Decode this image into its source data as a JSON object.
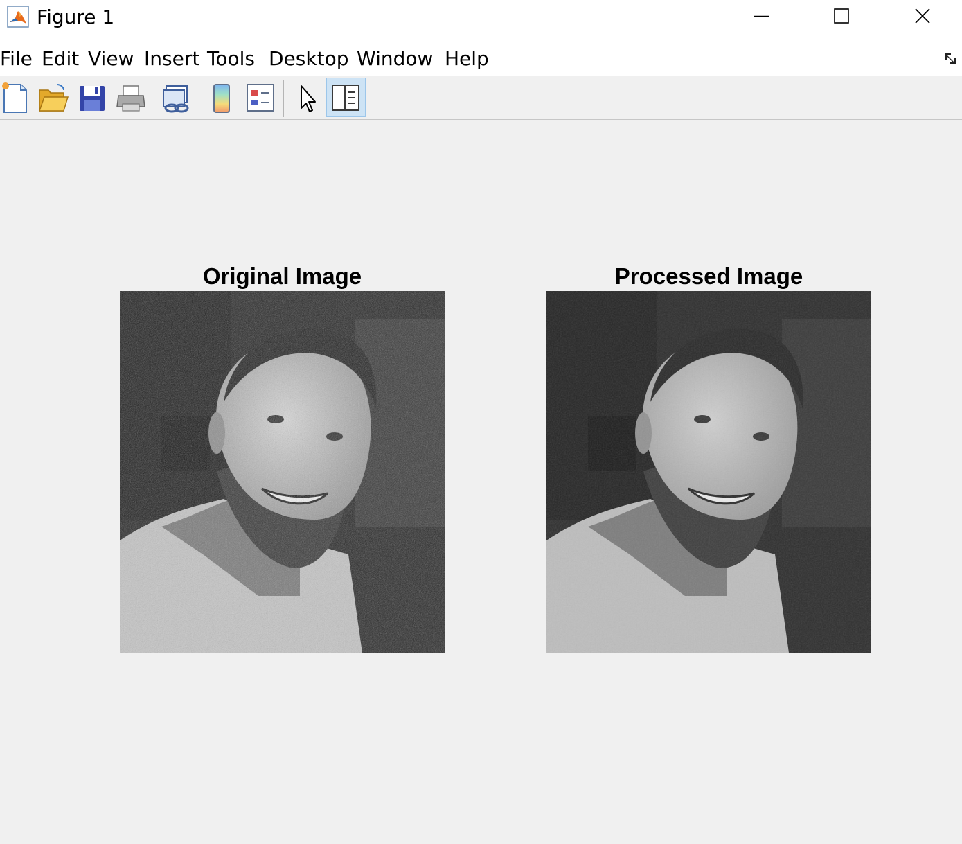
{
  "window": {
    "title": "Figure 1",
    "controls": [
      "minimize",
      "maximize",
      "close"
    ]
  },
  "menu": {
    "items": [
      "File",
      "Edit",
      "View",
      "Insert",
      "Tools",
      "Desktop",
      "Window",
      "Help"
    ]
  },
  "toolbar": {
    "buttons": [
      {
        "icon": "new-figure-icon"
      },
      {
        "icon": "open-file-icon"
      },
      {
        "icon": "save-icon"
      },
      {
        "icon": "print-icon"
      },
      {
        "icon": "link-plot-icon"
      },
      {
        "icon": "colorbar-icon"
      },
      {
        "icon": "legend-icon"
      },
      {
        "icon": "edit-plot-cursor-icon"
      },
      {
        "icon": "property-inspector-icon",
        "active": true
      }
    ]
  },
  "figure": {
    "axes": [
      {
        "title": "Original Image",
        "image": "grayscale portrait photo of a smiling bearded man (noisy)"
      },
      {
        "title": "Processed Image",
        "image": "grayscale portrait photo of a smiling bearded man (smoothed)"
      }
    ]
  },
  "colors": {
    "window_bg": "#f0f0f0",
    "titlebar_bg": "#ffffff",
    "active_tool": "#cde3f5"
  }
}
